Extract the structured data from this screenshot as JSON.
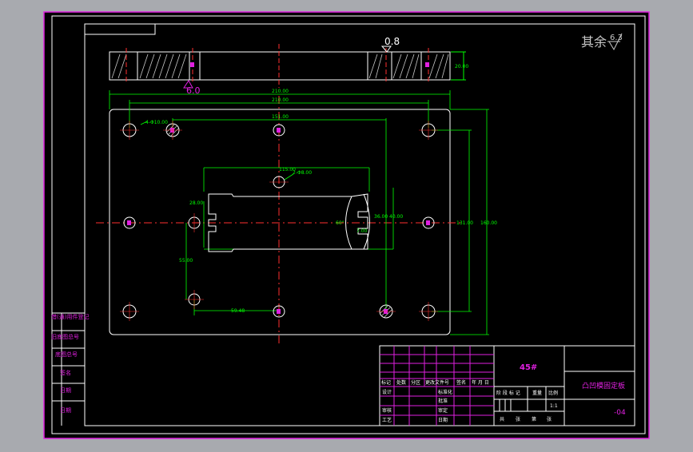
{
  "drawing": {
    "roughness_note": "其余",
    "roughness_default": "6.3",
    "section_roughness_top": "0.8",
    "section_roughness_bottom": "6.0",
    "section_height_dim": "20.00"
  },
  "dimensions": {
    "overall_width": "210.00",
    "hole_span_width": "210.00",
    "top_hole_pitch": "151.00",
    "hole_callout_4": "4-Φ10.00",
    "hole_callout_2": "2-Φ8.00",
    "slot_dim_1": "115.00",
    "slot_dim_2": "28.00",
    "slot_dim_3": "36.00",
    "slot_dim_4": "40.00",
    "slot_angle": "60°",
    "slot_small": "7.00",
    "left_height": "55.00",
    "bottom_offset": "59.48",
    "height_inner": "131.00",
    "height_outer": "160.00"
  },
  "side_table": {
    "rows": [
      "借(通)用件登记",
      "旧底图总号",
      "底图总号",
      "签名",
      "日期",
      "日期"
    ]
  },
  "title_block": {
    "material": "45#",
    "part_name": "凸凹模固定板",
    "drawing_no": "-04",
    "header_cols": [
      "标记",
      "处数",
      "分区",
      "更改文件号",
      "签名",
      "年 月 日"
    ],
    "left_roles": [
      "设计",
      "审核",
      "工艺"
    ],
    "mid_roles": [
      "标准化",
      "批准",
      "审定",
      "日期"
    ],
    "stage_headers": [
      "阶 段 标 记",
      "重量",
      "比例"
    ],
    "scale": "1:1",
    "sheet_info": [
      "共",
      "张",
      "第",
      "张"
    ]
  }
}
